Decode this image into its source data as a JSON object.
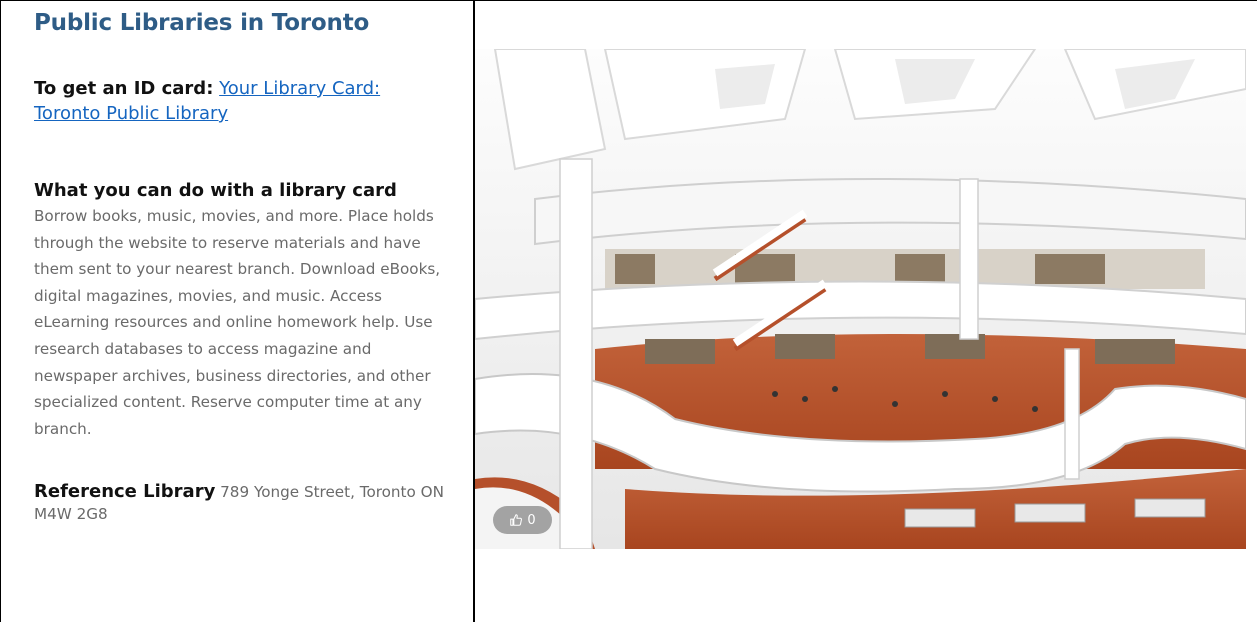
{
  "section": {
    "title": "Public Libraries in Toronto",
    "id_card": {
      "label": "To get an ID card:",
      "link_text": "Your Library Card: Toronto Public Library"
    },
    "library_card": {
      "heading": "What you can do with a library card",
      "description": "Borrow books, music, movies, and more. Place holds through the website to reserve materials and have them sent to your nearest branch. Download eBooks, digital magazines, movies, and music. Access eLearning resources and online homework help. Use research databases to access magazine and newspaper archives, business directories, and other specialized content. Reserve computer time at any branch."
    },
    "reference": {
      "label": "Reference Library",
      "address": "789 Yonge Street, Toronto ON M4W 2G8"
    }
  },
  "photo": {
    "likes": "0",
    "like_icon": "thumbs-up-icon"
  },
  "colors": {
    "title": "#2e5c86",
    "link": "#1565c0",
    "body_text": "#6a6a6a",
    "floor": "#b5502b"
  }
}
